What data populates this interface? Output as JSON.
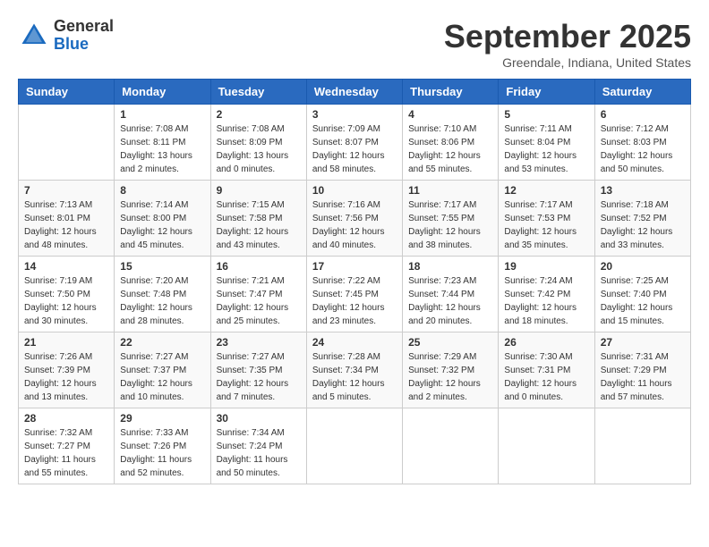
{
  "header": {
    "logo_general": "General",
    "logo_blue": "Blue",
    "month_title": "September 2025",
    "location": "Greendale, Indiana, United States"
  },
  "weekdays": [
    "Sunday",
    "Monday",
    "Tuesday",
    "Wednesday",
    "Thursday",
    "Friday",
    "Saturday"
  ],
  "weeks": [
    [
      {
        "day": "",
        "info": ""
      },
      {
        "day": "1",
        "info": "Sunrise: 7:08 AM\nSunset: 8:11 PM\nDaylight: 13 hours\nand 2 minutes."
      },
      {
        "day": "2",
        "info": "Sunrise: 7:08 AM\nSunset: 8:09 PM\nDaylight: 13 hours\nand 0 minutes."
      },
      {
        "day": "3",
        "info": "Sunrise: 7:09 AM\nSunset: 8:07 PM\nDaylight: 12 hours\nand 58 minutes."
      },
      {
        "day": "4",
        "info": "Sunrise: 7:10 AM\nSunset: 8:06 PM\nDaylight: 12 hours\nand 55 minutes."
      },
      {
        "day": "5",
        "info": "Sunrise: 7:11 AM\nSunset: 8:04 PM\nDaylight: 12 hours\nand 53 minutes."
      },
      {
        "day": "6",
        "info": "Sunrise: 7:12 AM\nSunset: 8:03 PM\nDaylight: 12 hours\nand 50 minutes."
      }
    ],
    [
      {
        "day": "7",
        "info": "Sunrise: 7:13 AM\nSunset: 8:01 PM\nDaylight: 12 hours\nand 48 minutes."
      },
      {
        "day": "8",
        "info": "Sunrise: 7:14 AM\nSunset: 8:00 PM\nDaylight: 12 hours\nand 45 minutes."
      },
      {
        "day": "9",
        "info": "Sunrise: 7:15 AM\nSunset: 7:58 PM\nDaylight: 12 hours\nand 43 minutes."
      },
      {
        "day": "10",
        "info": "Sunrise: 7:16 AM\nSunset: 7:56 PM\nDaylight: 12 hours\nand 40 minutes."
      },
      {
        "day": "11",
        "info": "Sunrise: 7:17 AM\nSunset: 7:55 PM\nDaylight: 12 hours\nand 38 minutes."
      },
      {
        "day": "12",
        "info": "Sunrise: 7:17 AM\nSunset: 7:53 PM\nDaylight: 12 hours\nand 35 minutes."
      },
      {
        "day": "13",
        "info": "Sunrise: 7:18 AM\nSunset: 7:52 PM\nDaylight: 12 hours\nand 33 minutes."
      }
    ],
    [
      {
        "day": "14",
        "info": "Sunrise: 7:19 AM\nSunset: 7:50 PM\nDaylight: 12 hours\nand 30 minutes."
      },
      {
        "day": "15",
        "info": "Sunrise: 7:20 AM\nSunset: 7:48 PM\nDaylight: 12 hours\nand 28 minutes."
      },
      {
        "day": "16",
        "info": "Sunrise: 7:21 AM\nSunset: 7:47 PM\nDaylight: 12 hours\nand 25 minutes."
      },
      {
        "day": "17",
        "info": "Sunrise: 7:22 AM\nSunset: 7:45 PM\nDaylight: 12 hours\nand 23 minutes."
      },
      {
        "day": "18",
        "info": "Sunrise: 7:23 AM\nSunset: 7:44 PM\nDaylight: 12 hours\nand 20 minutes."
      },
      {
        "day": "19",
        "info": "Sunrise: 7:24 AM\nSunset: 7:42 PM\nDaylight: 12 hours\nand 18 minutes."
      },
      {
        "day": "20",
        "info": "Sunrise: 7:25 AM\nSunset: 7:40 PM\nDaylight: 12 hours\nand 15 minutes."
      }
    ],
    [
      {
        "day": "21",
        "info": "Sunrise: 7:26 AM\nSunset: 7:39 PM\nDaylight: 12 hours\nand 13 minutes."
      },
      {
        "day": "22",
        "info": "Sunrise: 7:27 AM\nSunset: 7:37 PM\nDaylight: 12 hours\nand 10 minutes."
      },
      {
        "day": "23",
        "info": "Sunrise: 7:27 AM\nSunset: 7:35 PM\nDaylight: 12 hours\nand 7 minutes."
      },
      {
        "day": "24",
        "info": "Sunrise: 7:28 AM\nSunset: 7:34 PM\nDaylight: 12 hours\nand 5 minutes."
      },
      {
        "day": "25",
        "info": "Sunrise: 7:29 AM\nSunset: 7:32 PM\nDaylight: 12 hours\nand 2 minutes."
      },
      {
        "day": "26",
        "info": "Sunrise: 7:30 AM\nSunset: 7:31 PM\nDaylight: 12 hours\nand 0 minutes."
      },
      {
        "day": "27",
        "info": "Sunrise: 7:31 AM\nSunset: 7:29 PM\nDaylight: 11 hours\nand 57 minutes."
      }
    ],
    [
      {
        "day": "28",
        "info": "Sunrise: 7:32 AM\nSunset: 7:27 PM\nDaylight: 11 hours\nand 55 minutes."
      },
      {
        "day": "29",
        "info": "Sunrise: 7:33 AM\nSunset: 7:26 PM\nDaylight: 11 hours\nand 52 minutes."
      },
      {
        "day": "30",
        "info": "Sunrise: 7:34 AM\nSunset: 7:24 PM\nDaylight: 11 hours\nand 50 minutes."
      },
      {
        "day": "",
        "info": ""
      },
      {
        "day": "",
        "info": ""
      },
      {
        "day": "",
        "info": ""
      },
      {
        "day": "",
        "info": ""
      }
    ]
  ]
}
